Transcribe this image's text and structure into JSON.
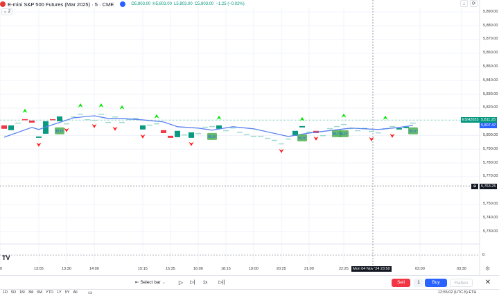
{
  "header": {
    "title": "E-mini S&P 500 Futures (Mar 2025) · 5 · CME",
    "open": "O5,803.00",
    "high": "H5,803.00",
    "low": "L5,803.00",
    "close": "C5,803.00",
    "change": "−1.25 (−0.02%)",
    "indicator_chip": "⌄ 2",
    "icons": [
      "futures-symbol-icon",
      "data-status-icon",
      "download-icon",
      "refresh-icon"
    ]
  },
  "price_axis": {
    "labels": [
      "5,890.00",
      "5,880.00",
      "5,870.00",
      "5,860.00",
      "5,850.00",
      "5,840.00",
      "5,830.00",
      "5,820.00",
      "5,800.00",
      "5,790.00",
      "5,780.00",
      "5,770.00",
      "5,750.00",
      "5,740.00",
      "5,730.00"
    ],
    "values": [
      5890,
      5880,
      5870,
      5860,
      5850,
      5840,
      5830,
      5820,
      5800,
      5790,
      5780,
      5770,
      5750,
      5740,
      5730
    ],
    "symbol_tag": "ESH2025",
    "last_price": "5,811.25",
    "ma_price": "5,807.47",
    "crosshair_price": "5,763.25",
    "pane2_value": "0"
  },
  "time_axis": {
    "labels": [
      "0",
      "13:05",
      "13:30",
      "14:00",
      "15:15",
      "15:35",
      "16:00",
      "18:15",
      "19:00",
      "20:25",
      "21:00",
      "22:25",
      "03:00",
      "03:30"
    ],
    "crosshair_label": "Mon 04 Nov '24  23:50"
  },
  "colors": {
    "up": "#089981",
    "down": "#f23645",
    "doji": "#9fd9cf",
    "ma": "#5b83f0",
    "buy_signal": "#00e600",
    "sell_signal": "#ff1a1a",
    "buy_label": "#4caf50",
    "sell_button": "#f23645",
    "buy_button": "#2962ff"
  },
  "chart_data": {
    "type": "candlestick",
    "bars": [
      [
        5807.4,
        5804.9
      ],
      [
        5803.9,
        5807.4
      ],
      [
        5809.4,
        5809.4
      ],
      [
        5811.9,
        5811.4
      ],
      [
        5810.9,
        5809.4
      ],
      [
        5798.3,
        5799.3
      ],
      [
        5801.3,
        5810.4
      ],
      [
        5811.9,
        5811.4
      ],
      [
        5810.4,
        5813.9
      ],
      [
        5808.9,
        5808.9
      ],
      [
        5813.9,
        5813.9
      ],
      [
        5815.9,
        5815.9
      ],
      [
        5811.9,
        5811.9
      ],
      [
        5811.4,
        5811.4
      ],
      [
        5815.9,
        5815.9
      ],
      [
        5809.9,
        5809.9
      ],
      [
        5813.9,
        5813.9
      ],
      [
        5809.9,
        5809.9
      ],
      [
        5812,
        5812
      ],
      [
        5812.9,
        5812.9
      ],
      [
        5804.4,
        5807.4
      ],
      [
        5807.9,
        5807.9
      ],
      [
        5808.9,
        5808.9
      ],
      [
        5803.9,
        5801.8
      ],
      [
        5799.8,
        5798.3
      ],
      [
        5798.8,
        5803.4
      ],
      [
        5800.8,
        5800.8
      ],
      [
        5798.3,
        5802.3
      ],
      [
        5801.8,
        5801.8
      ],
      [
        5806.4,
        5806.4
      ],
      [
        5806.9,
        5806.9
      ],
      [
        5804.9,
        5807.4
      ],
      [
        5803.9,
        5803.9
      ],
      [
        5805.9,
        5805.9
      ],
      [
        5802.8,
        5802.8
      ],
      [
        5801,
        5801
      ],
      [
        5799.8,
        5799.8
      ],
      [
        5799.8,
        5799.8
      ],
      [
        5798.3,
        5798.3
      ],
      [
        5796.8,
        5796.8
      ],
      [
        5794.3,
        5794.3
      ],
      [
        5797.8,
        5797.8
      ],
      [
        5799.8,
        5803.4
      ],
      [
        5805.9,
        5806.9
      ],
      [
        5802.8,
        5802.8
      ],
      [
        5803.4,
        5801.8
      ],
      [
        5800.3,
        5800.3
      ],
      [
        5805.4,
        5805.4
      ],
      [
        5806.9,
        5806.9
      ],
      [
        5808.4,
        5808.4
      ],
      [
        5805.4,
        5805.4
      ],
      [
        5803.9,
        5803.9
      ],
      [
        5804.9,
        5805.4
      ],
      [
        5803.4,
        5803.4
      ],
      [
        5802.3,
        5802.3
      ],
      [
        5805.4,
        5805.4
      ],
      [
        5806.9,
        5806.9
      ],
      [
        5804.4,
        5805.4
      ],
      [
        5805.4,
        5806.4
      ],
      [
        5809.4,
        5809.4
      ]
    ],
    "ma": [
      [
        0,
        5798.8
      ],
      [
        4,
        5805.9
      ],
      [
        5,
        5804.4
      ],
      [
        7,
        5807.9
      ],
      [
        10,
        5812.9
      ],
      [
        13,
        5814.4
      ],
      [
        15,
        5812.4
      ],
      [
        17,
        5812.4
      ],
      [
        20,
        5811.4
      ],
      [
        23,
        5809.9
      ],
      [
        25,
        5806.4
      ],
      [
        28,
        5805.4
      ],
      [
        30,
        5803.9
      ],
      [
        33,
        5806.4
      ],
      [
        36,
        5804.9
      ],
      [
        41,
        5799.3
      ],
      [
        44,
        5801.8
      ],
      [
        50,
        5805.4
      ],
      [
        54,
        5804.4
      ],
      [
        57,
        5805.9
      ],
      [
        59,
        5807.4
      ]
    ],
    "up_signals": [
      [
        3,
        5818
      ],
      [
        11,
        5822
      ],
      [
        14,
        5822
      ],
      [
        17,
        5820.5
      ],
      [
        22,
        5814
      ],
      [
        31,
        5813
      ],
      [
        43,
        5812
      ],
      [
        49,
        5814.5
      ],
      [
        55,
        5813
      ]
    ],
    "down_signals": [
      [
        5,
        5793.3
      ],
      [
        9,
        5803.9
      ],
      [
        13,
        5806.9
      ],
      [
        16,
        5804.9
      ],
      [
        20,
        5799.3
      ],
      [
        27,
        5793.8
      ],
      [
        40,
        5788.7
      ],
      [
        45,
        5797.8
      ],
      [
        53,
        5797.3
      ],
      [
        56,
        5799.8
      ]
    ],
    "buy_labels": [
      [
        8,
        5803.4
      ],
      [
        30,
        5799.3
      ],
      [
        43,
        5798.3
      ],
      [
        48,
        5801.3
      ],
      [
        49,
        5801.3
      ],
      [
        59,
        5803.4
      ]
    ],
    "buy_label_text": "BUY",
    "ylim": [
      5725,
      5895
    ]
  },
  "toolbar": {
    "select_bar": "Select bar",
    "speed": "1x",
    "sell": "Sell",
    "quantity": "1",
    "buy": "Buy",
    "flatten": "Flatten"
  },
  "bottom": {
    "ranges": [
      "1D",
      "5D",
      "1M",
      "3M",
      "6M",
      "YTD",
      "1Y",
      "5Y",
      "All"
    ],
    "clock": "12:55:02 (UTC-5)",
    "session": "ETH"
  }
}
